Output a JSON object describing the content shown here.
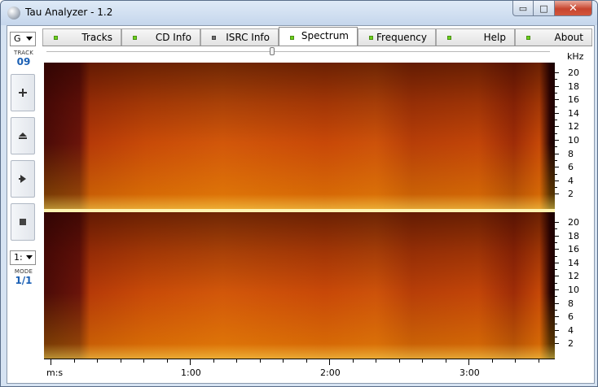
{
  "window": {
    "title": "Tau Analyzer - 1.2"
  },
  "caption_buttons": {
    "minimize": "▭",
    "maximize": "□",
    "close": "✕"
  },
  "left_panel": {
    "drive_combo": "G",
    "track_label": "TRACK",
    "track_value": "09",
    "buttons": [
      "plus-icon",
      "eject-icon",
      "play-icon",
      "stop-icon"
    ],
    "mode_combo": "1:",
    "mode_label": "MODE",
    "mode_value": "1/1"
  },
  "tabs": [
    {
      "label": "Tracks",
      "indicator": "green"
    },
    {
      "label": "CD Info",
      "indicator": "green"
    },
    {
      "label": "ISRC Info",
      "indicator": "gray"
    },
    {
      "label": "Spectrum",
      "indicator": "green",
      "active": true
    },
    {
      "label": "Frequency",
      "indicator": "green"
    },
    {
      "label": "Help",
      "indicator": "green"
    },
    {
      "label": "About",
      "indicator": "green"
    }
  ],
  "spectrum": {
    "y_unit": "kHz",
    "y_ticks": [
      "20",
      "18",
      "16",
      "14",
      "12",
      "10",
      "8",
      "6",
      "4",
      "2"
    ],
    "x_unit_label": "m:s",
    "x_ticks": [
      "1:00",
      "2:00",
      "3:00"
    ],
    "colors": {
      "low": "#2a0503",
      "mid": "#c84a08",
      "high": "#fff3b0"
    }
  }
}
